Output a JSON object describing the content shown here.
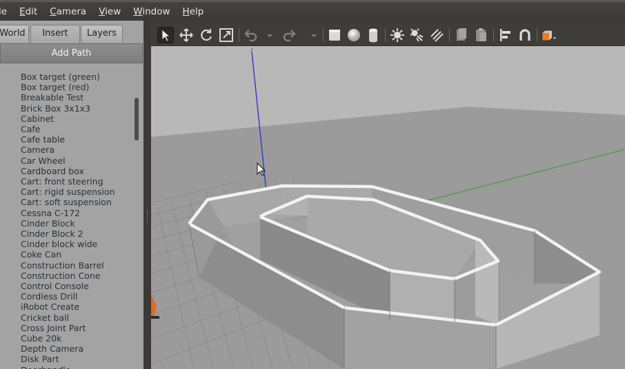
{
  "menu": [
    "File",
    "Edit",
    "Camera",
    "View",
    "Window",
    "Help"
  ],
  "menu_underline": [
    "F",
    "E",
    "C",
    "V",
    "W",
    "H"
  ],
  "tabs": {
    "world": "World",
    "insert": "Insert",
    "layers": "Layers"
  },
  "add_path_label": "Add Path",
  "models": [
    "Box target (green)",
    "Box target (red)",
    "Breakable Test",
    "Brick Box 3x1x3",
    "Cabinet",
    "Cafe",
    "Cafe table",
    "Camera",
    "Car Wheel",
    "Cardboard box",
    "Cart: front steering",
    "Cart: rigid suspension",
    "Cart: soft suspension",
    "Cessna C-172",
    "Cinder Block",
    "Cinder Block 2",
    "Cinder block wide",
    "Coke Can",
    "Construction Barrel",
    "Construction Cone",
    "Control Console",
    "Cordless Drill",
    "iRobot Create",
    "Cricket ball",
    "Cross Joint Part",
    "Cube 20k",
    "Depth Camera",
    "Disk Part",
    "Doorhandle"
  ],
  "toolbar_icons": [
    "select-arrow-icon",
    "translate-icon",
    "rotate-icon",
    "scale-icon",
    "undo-icon",
    "undo-history-icon",
    "redo-icon",
    "redo-history-icon",
    "box-shape-icon",
    "sphere-shape-icon",
    "cylinder-shape-icon",
    "point-light-icon",
    "spot-light-icon",
    "directional-light-icon",
    "copy-icon",
    "paste-icon",
    "align-icon",
    "snap-icon",
    "view-angle-icon"
  ],
  "colors": {
    "accent_orange": "#f07a1e",
    "panel_bg": "#a3a3a3",
    "sky": "#b9b9b9",
    "ground": "#9a9a9a"
  }
}
